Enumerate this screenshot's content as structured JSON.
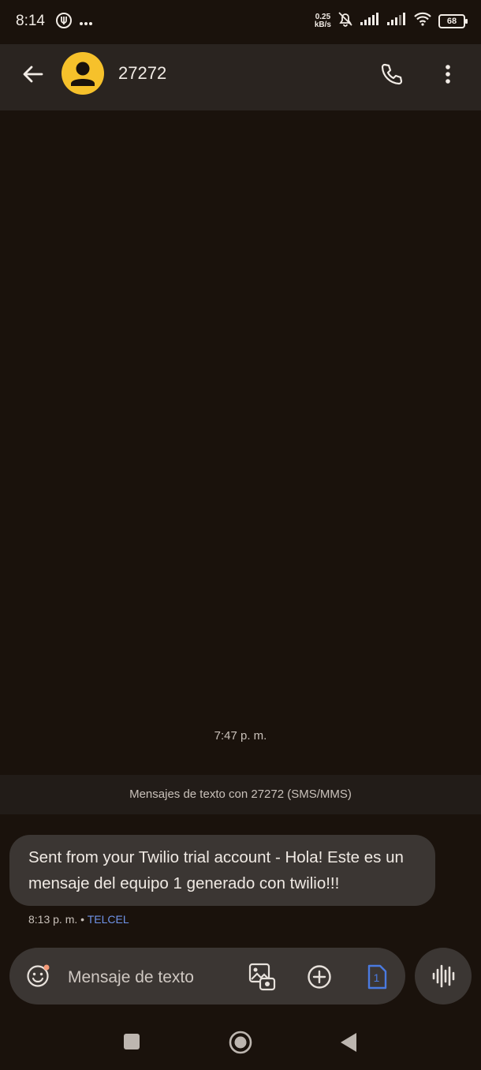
{
  "status_bar": {
    "time": "8:14",
    "net_speed_value": "0.25",
    "net_speed_unit": "kB/s",
    "battery": "68"
  },
  "header": {
    "contact": "27272",
    "avatar_color": "#f6c12b"
  },
  "conversation": {
    "date_separator": "7:47 p. m.",
    "info_banner": "Mensajes de texto con 27272 (SMS/MMS)",
    "messages": [
      {
        "text": "Sent from your Twilio trial account - Hola! Este es un mensaje del equipo 1 generado con twilio!!!",
        "time": "8:13 p. m.",
        "separator": "•",
        "carrier": "TELCEL"
      }
    ]
  },
  "composer": {
    "placeholder": "Mensaje de texto",
    "sim_slot": "1"
  },
  "icons": [
    "back-arrow-icon",
    "person-icon",
    "phone-icon",
    "more-vert-icon",
    "emoji-icon",
    "gallery-icon",
    "add-icon",
    "sim-icon",
    "voice-icon"
  ],
  "colors": {
    "background": "#1a120c",
    "appbar": "#2a2420",
    "bubble": "#3b3633",
    "accent_blue": "#6f93e8"
  }
}
